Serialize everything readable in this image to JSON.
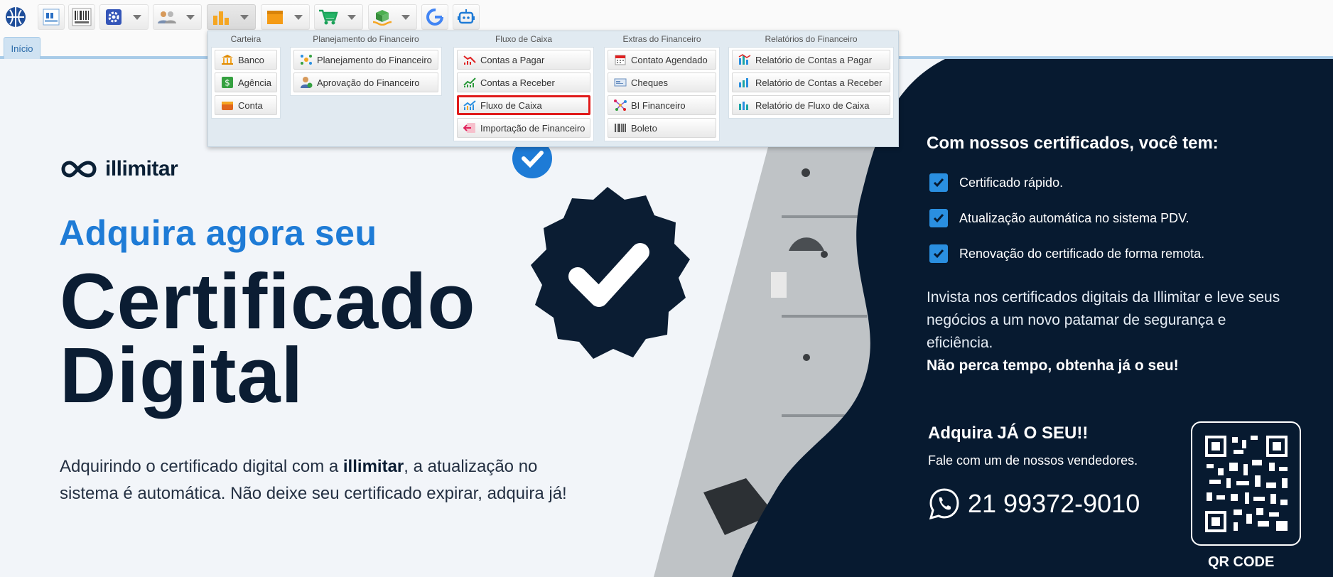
{
  "tabs": [
    {
      "label": "Início"
    }
  ],
  "menu": {
    "columns": [
      {
        "title": "Carteira",
        "items": [
          {
            "label": "Banco",
            "icon": "bank-icon"
          },
          {
            "label": "Agência",
            "icon": "dollar-icon"
          },
          {
            "label": "Conta",
            "icon": "wallet-icon"
          }
        ]
      },
      {
        "title": "Planejamento do Financeiro",
        "items": [
          {
            "label": "Planejamento do Financeiro",
            "icon": "network-icon"
          },
          {
            "label": "Aprovação do Financeiro",
            "icon": "user-approve-icon"
          }
        ]
      },
      {
        "title": "Fluxo de Caixa",
        "items": [
          {
            "label": "Contas a Pagar",
            "icon": "chart-down-icon"
          },
          {
            "label": "Contas a Receber",
            "icon": "chart-up-icon"
          },
          {
            "label": "Fluxo de Caixa",
            "icon": "chart-flow-icon"
          },
          {
            "label": "Importação de Financeiro",
            "icon": "import-icon"
          }
        ]
      },
      {
        "title": "Extras do Financeiro",
        "items": [
          {
            "label": "Contato Agendado",
            "icon": "calendar-icon"
          },
          {
            "label": "Cheques",
            "icon": "check-paper-icon"
          },
          {
            "label": "BI Financeiro",
            "icon": "bi-icon"
          },
          {
            "label": "Boleto",
            "icon": "barcode-icon"
          }
        ]
      },
      {
        "title": "Relatórios do Financeiro",
        "items": [
          {
            "label": "Relatório de Contas a Pagar",
            "icon": "report-bar-icon"
          },
          {
            "label": "Relatório de Contas a Receber",
            "icon": "report-bar-icon"
          },
          {
            "label": "Relatório de Fluxo de Caixa",
            "icon": "report-bar-icon"
          }
        ]
      }
    ]
  },
  "banner": {
    "logo_text": "illimitar",
    "heading_sub": "Adquira agora seu",
    "heading_line1": "Certificado",
    "heading_line2": "Digital",
    "para_start": "Adquirindo o certificado digital com a ",
    "para_brand": "illimitar",
    "para_end": ", a atualização no sistema é automática. Não deixe seu certificado expirar, adquira já!",
    "right_title": "Com nossos certificados, você tem:",
    "benefits": [
      "Certificado rápido.",
      "Atualização automática no sistema PDV.",
      "Renovação do certificado de forma remota."
    ],
    "right_para": "Invista nos certificados digitais da Illimitar e leve seus negócios a um novo patamar de segurança e eficiência.",
    "right_bold": "Não perca tempo, obtenha já o seu!",
    "cta_title": "Adquira JÁ O SEU!!",
    "cta_sub": "Fale com um de nossos vendedores.",
    "phone": "21 99372-9010",
    "qr_label": "QR CODE"
  },
  "colors": {
    "accent_blue": "#1e7bd6",
    "navy": "#0b1d33",
    "highlight_red": "#e01b1b"
  }
}
